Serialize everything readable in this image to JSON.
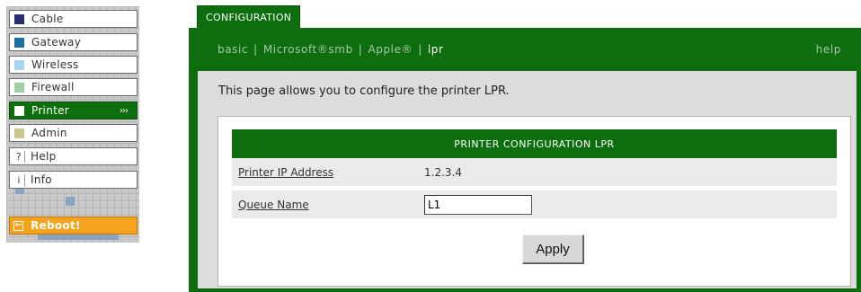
{
  "nav": {
    "items": [
      {
        "label": "Cable",
        "swatch": "#2b2f6e"
      },
      {
        "label": "Gateway",
        "swatch": "#1a6fa3"
      },
      {
        "label": "Wireless",
        "swatch": "#a8d4f0"
      },
      {
        "label": "Firewall",
        "swatch": "#9fd0a3"
      },
      {
        "label": "Printer",
        "swatch": "#ffffff",
        "arrows": "›››"
      },
      {
        "label": "Admin",
        "swatch": "#c9c78d"
      },
      {
        "label": "Help",
        "glyph": "?"
      },
      {
        "label": "Info",
        "glyph": "i"
      }
    ],
    "reboot_label": "Reboot!",
    "reboot_icon": "←"
  },
  "tab": {
    "label": "CONFIGURATION"
  },
  "subnav": {
    "basic": "basic",
    "smb": "Microsoft®smb",
    "apple": "Apple®",
    "lpr": "lpr",
    "help": "help"
  },
  "page": {
    "description": "This page allows you to configure the printer LPR.",
    "table_title": "PRINTER CONFIGURATION LPR",
    "ip_label": "Printer IP Address",
    "ip_value": "1.2.3.4",
    "queue_label": "Queue Name",
    "queue_value": "L1",
    "apply_label": "Apply"
  },
  "colors": {
    "accent_green": "#0d6e0d",
    "reboot_orange": "#f5a21c"
  }
}
